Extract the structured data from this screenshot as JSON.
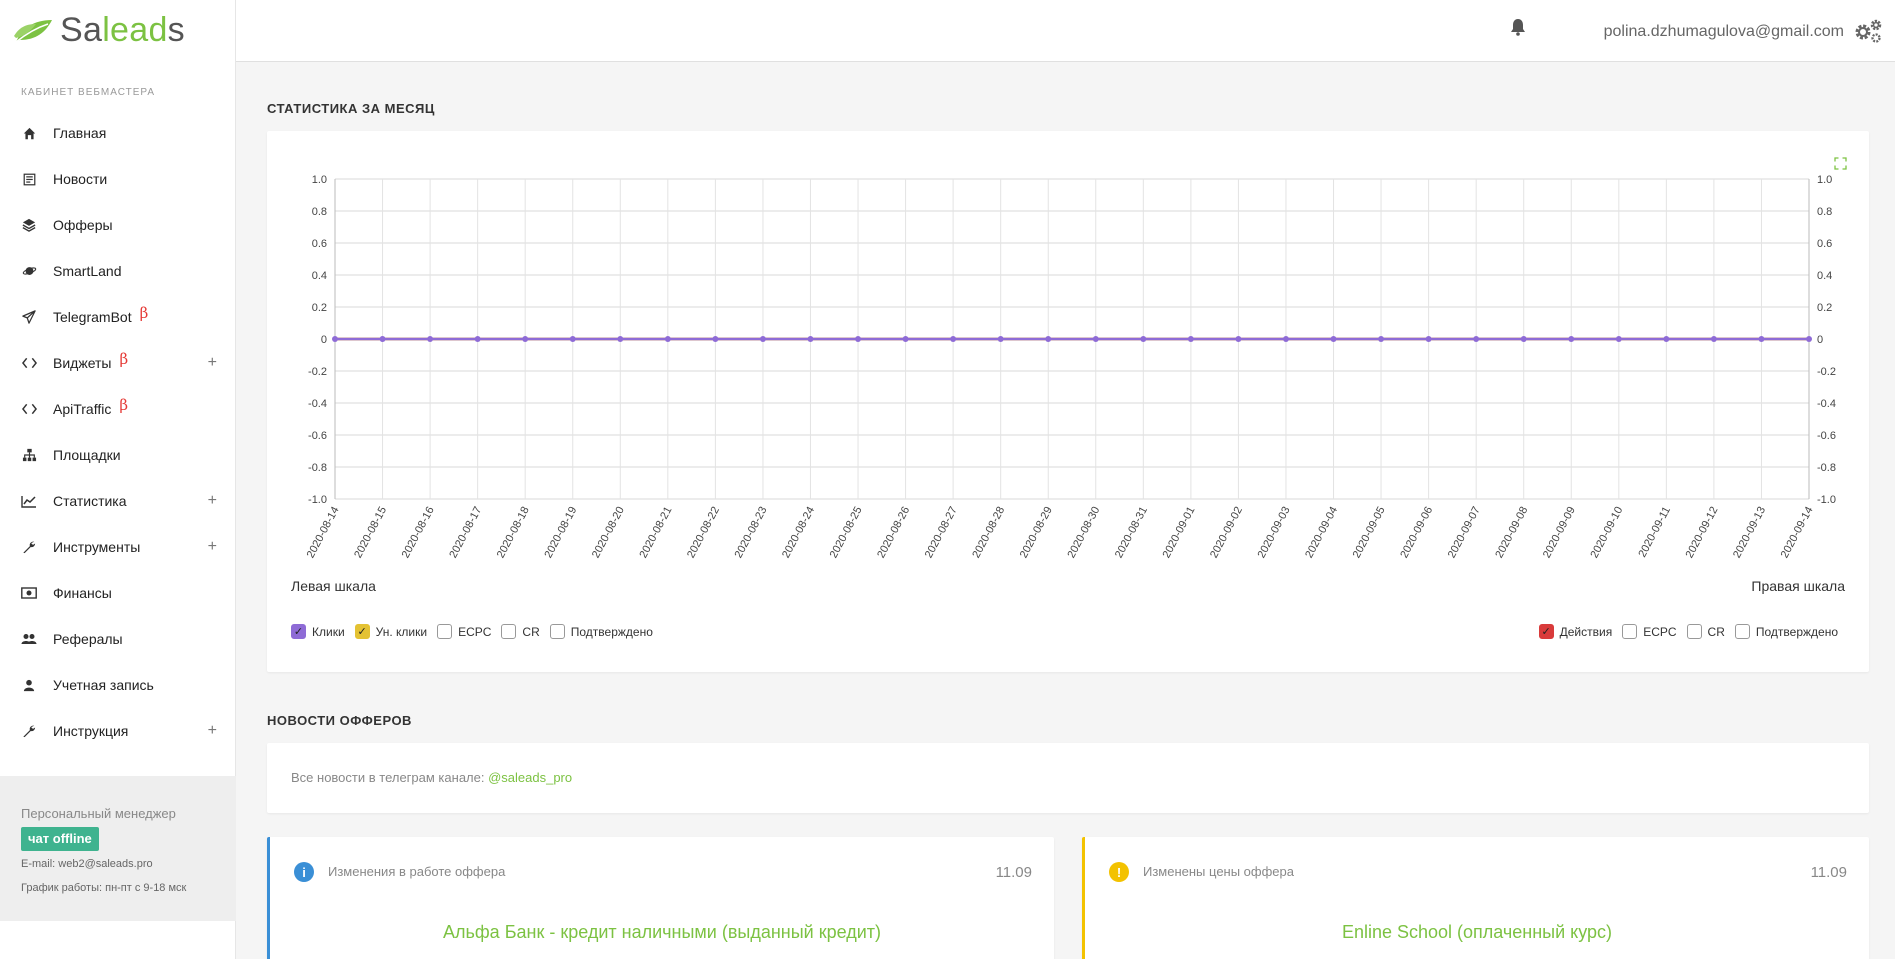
{
  "app": {
    "logo_prefix": "Sa",
    "logo_mid": "lead",
    "logo_suffix": "s"
  },
  "sidebar": {
    "caption": "КАБИНЕТ ВЕБМАСТЕРА",
    "items": [
      {
        "label": "Главная",
        "icon": "home-icon"
      },
      {
        "label": "Новости",
        "icon": "news-icon"
      },
      {
        "label": "Офферы",
        "icon": "layers-icon"
      },
      {
        "label": "SmartLand",
        "icon": "planet-icon"
      },
      {
        "label": "TelegramBot",
        "icon": "send-icon",
        "beta": "β"
      },
      {
        "label": "Виджеты",
        "icon": "code-icon",
        "beta": "β",
        "plus": "+"
      },
      {
        "label": "ApiTraffic",
        "icon": "code-icon",
        "beta": "β"
      },
      {
        "label": "Площадки",
        "icon": "sitemap-icon"
      },
      {
        "label": "Статистика",
        "icon": "line-chart-icon",
        "plus": "+"
      },
      {
        "label": "Инструменты",
        "icon": "wrench-icon",
        "plus": "+"
      },
      {
        "label": "Финансы",
        "icon": "money-icon"
      },
      {
        "label": "Рефералы",
        "icon": "users-icon"
      },
      {
        "label": "Учетная запись",
        "icon": "user-icon"
      },
      {
        "label": "Инструкция",
        "icon": "wrench-icon",
        "plus": "+"
      }
    ],
    "manager": {
      "title": "Персональный менеджер",
      "chat": "чат offline",
      "email": "E-mail: web2@saleads.pro",
      "hours": "График работы: пн-пт с 9-18 мск"
    }
  },
  "topbar": {
    "email": "polina.dzhumagulova@gmail.com"
  },
  "stats": {
    "title": "СТАТИСТИКА ЗА МЕСЯЦ",
    "scale_left": "Левая шкала",
    "scale_right": "Правая шкала",
    "legend_left": [
      {
        "label": "Клики",
        "checked": true,
        "color": "#8e6bd6"
      },
      {
        "label": "Ун. клики",
        "checked": true,
        "color": "#e4c233"
      },
      {
        "label": "ECPC",
        "checked": false
      },
      {
        "label": "CR",
        "checked": false
      },
      {
        "label": "Подтверждено",
        "checked": false
      }
    ],
    "legend_right": [
      {
        "label": "Действия",
        "checked": true,
        "color": "#d93b3b"
      },
      {
        "label": "ECPC",
        "checked": false
      },
      {
        "label": "CR",
        "checked": false
      },
      {
        "label": "Подтверждено",
        "checked": false
      }
    ]
  },
  "chart_data": {
    "type": "line",
    "x": [
      "2020-08-14",
      "2020-08-15",
      "2020-08-16",
      "2020-08-17",
      "2020-08-18",
      "2020-08-19",
      "2020-08-20",
      "2020-08-21",
      "2020-08-22",
      "2020-08-23",
      "2020-08-24",
      "2020-08-25",
      "2020-08-26",
      "2020-08-27",
      "2020-08-28",
      "2020-08-29",
      "2020-08-30",
      "2020-08-31",
      "2020-09-01",
      "2020-09-02",
      "2020-09-03",
      "2020-09-04",
      "2020-09-05",
      "2020-09-06",
      "2020-09-07",
      "2020-09-08",
      "2020-09-09",
      "2020-09-10",
      "2020-09-11",
      "2020-09-12",
      "2020-09-13",
      "2020-09-14"
    ],
    "series": [
      {
        "name": "Клики",
        "color": "#8e6bd6",
        "values": [
          0,
          0,
          0,
          0,
          0,
          0,
          0,
          0,
          0,
          0,
          0,
          0,
          0,
          0,
          0,
          0,
          0,
          0,
          0,
          0,
          0,
          0,
          0,
          0,
          0,
          0,
          0,
          0,
          0,
          0,
          0,
          0
        ]
      },
      {
        "name": "Ун. клики",
        "color": "#e4c233",
        "values": [
          0,
          0,
          0,
          0,
          0,
          0,
          0,
          0,
          0,
          0,
          0,
          0,
          0,
          0,
          0,
          0,
          0,
          0,
          0,
          0,
          0,
          0,
          0,
          0,
          0,
          0,
          0,
          0,
          0,
          0,
          0,
          0
        ]
      },
      {
        "name": "Действия",
        "color": "#d93b3b",
        "values": [
          0,
          0,
          0,
          0,
          0,
          0,
          0,
          0,
          0,
          0,
          0,
          0,
          0,
          0,
          0,
          0,
          0,
          0,
          0,
          0,
          0,
          0,
          0,
          0,
          0,
          0,
          0,
          0,
          0,
          0,
          0,
          0
        ]
      }
    ],
    "yticks": [
      "1.0",
      "0.8",
      "0.6",
      "0.4",
      "0.2",
      "0",
      "-0.2",
      "-0.4",
      "-0.6",
      "-0.8",
      "-1.0"
    ],
    "ylim": [
      -1,
      1
    ],
    "grid": true
  },
  "offers_news": {
    "title": "НОВОСТИ ОФФЕРОВ",
    "telegram_text": "Все новости в телеграм канале: ",
    "telegram_link": "@saleads_pro",
    "cards": [
      {
        "head": "Изменения в работе оффера",
        "date": "11.09",
        "name": "Альфа Банк - кредит наличными (выданный кредит)",
        "icon": "info-icon",
        "color": "#3a8fd6"
      },
      {
        "head": "Изменены цены оффера",
        "date": "11.09",
        "name": "Enline School (оплаченный курс)",
        "icon": "warning-icon",
        "color": "#f3c200"
      }
    ]
  }
}
